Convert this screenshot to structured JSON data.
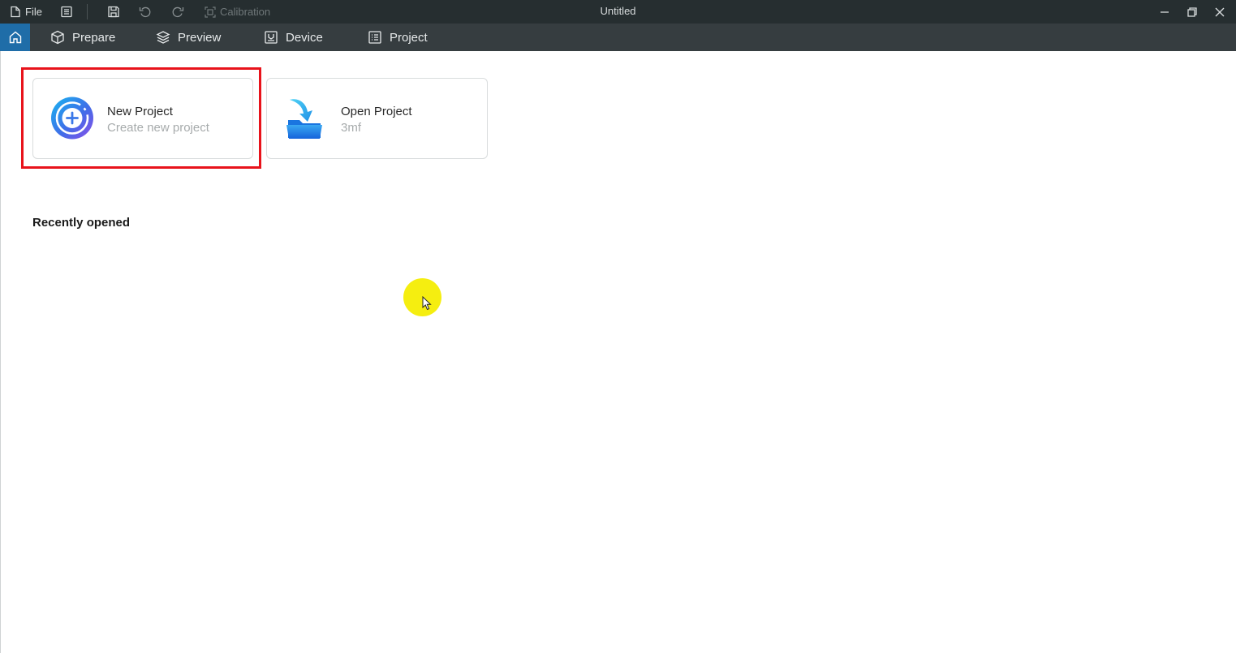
{
  "titlebar": {
    "file_label": "File",
    "calibration_label": "Calibration",
    "window_title": "Untitled"
  },
  "tabs": [
    {
      "label": "Prepare",
      "icon": "cube-icon"
    },
    {
      "label": "Preview",
      "icon": "layers-icon"
    },
    {
      "label": "Device",
      "icon": "device-icon"
    },
    {
      "label": "Project",
      "icon": "list-icon"
    }
  ],
  "home": {
    "new_project": {
      "title": "New Project",
      "subtitle": "Create new project"
    },
    "open_project": {
      "title": "Open Project",
      "subtitle": "3mf"
    },
    "recent_title": "Recently opened"
  },
  "colors": {
    "titlebar_bg": "#262e30",
    "tabbar_bg": "#363d40",
    "home_tab_active": "#1f6da8",
    "highlight": "#e8131b",
    "cursor_dot": "#f5ee10"
  }
}
